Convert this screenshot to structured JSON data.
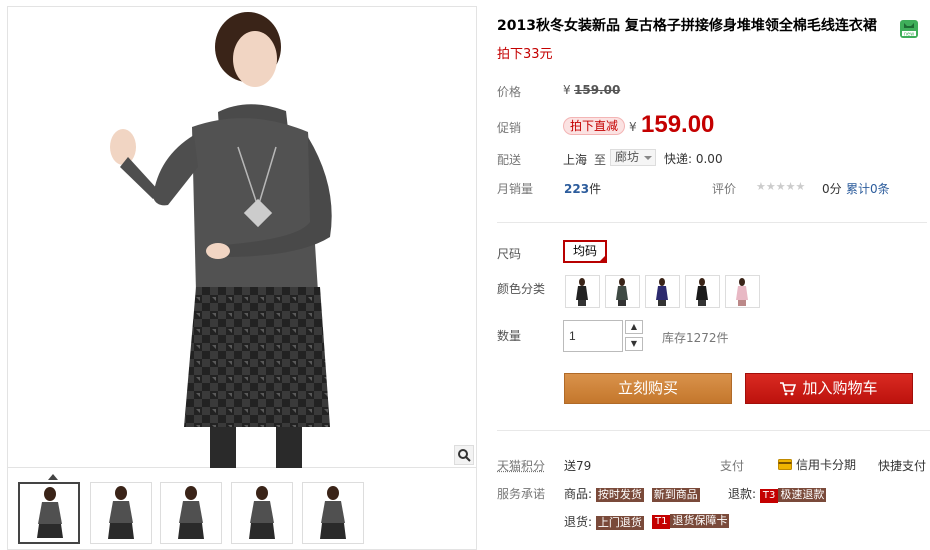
{
  "product": {
    "title": "2013秋冬女装新品 复古格子拼接修身堆堆领全棉毛线连衣裙",
    "subtitle": "拍下33元"
  },
  "price": {
    "label": "价格",
    "currency": "¥",
    "original": "159.00",
    "promo_label": "促销",
    "promo_tag": "拍下直减",
    "promo_price": "159.00"
  },
  "delivery": {
    "label": "配送",
    "from": "上海",
    "to_word": "至",
    "dest": "廊坊",
    "shipping": "快递: 0.00"
  },
  "sales": {
    "label": "月销量",
    "count": "223",
    "unit": "件",
    "rating_label": "评价",
    "stars": "★★★★★",
    "score": "0分",
    "reviews": "累计0条"
  },
  "options": {
    "size_label": "尺码",
    "size_value": "均码",
    "color_label": "颜色分类",
    "colors": [
      "black",
      "dark-green",
      "blue",
      "black-2",
      "pink"
    ],
    "qty_label": "数量",
    "qty_value": "1",
    "stock": "库存1272件"
  },
  "actions": {
    "buy": "立刻购买",
    "cart": "加入购物车"
  },
  "services": {
    "points_label": "天猫积分",
    "points_value": "送79",
    "pay_label": "支付",
    "credit": "信用卡分期",
    "quick_pay": "快捷支付",
    "promise_label": "服务承诺",
    "goods_label": "商品:",
    "goods_tag1": "按时发货",
    "goods_tag2": "新到商品",
    "return_label": "退款:",
    "return_badge": "T3",
    "return_tag": "极速退款",
    "exchange_label": "退货:",
    "exchange_tag": "上门退货",
    "exchange_badge": "T1",
    "exchange_tag2": "退货保障卡"
  }
}
